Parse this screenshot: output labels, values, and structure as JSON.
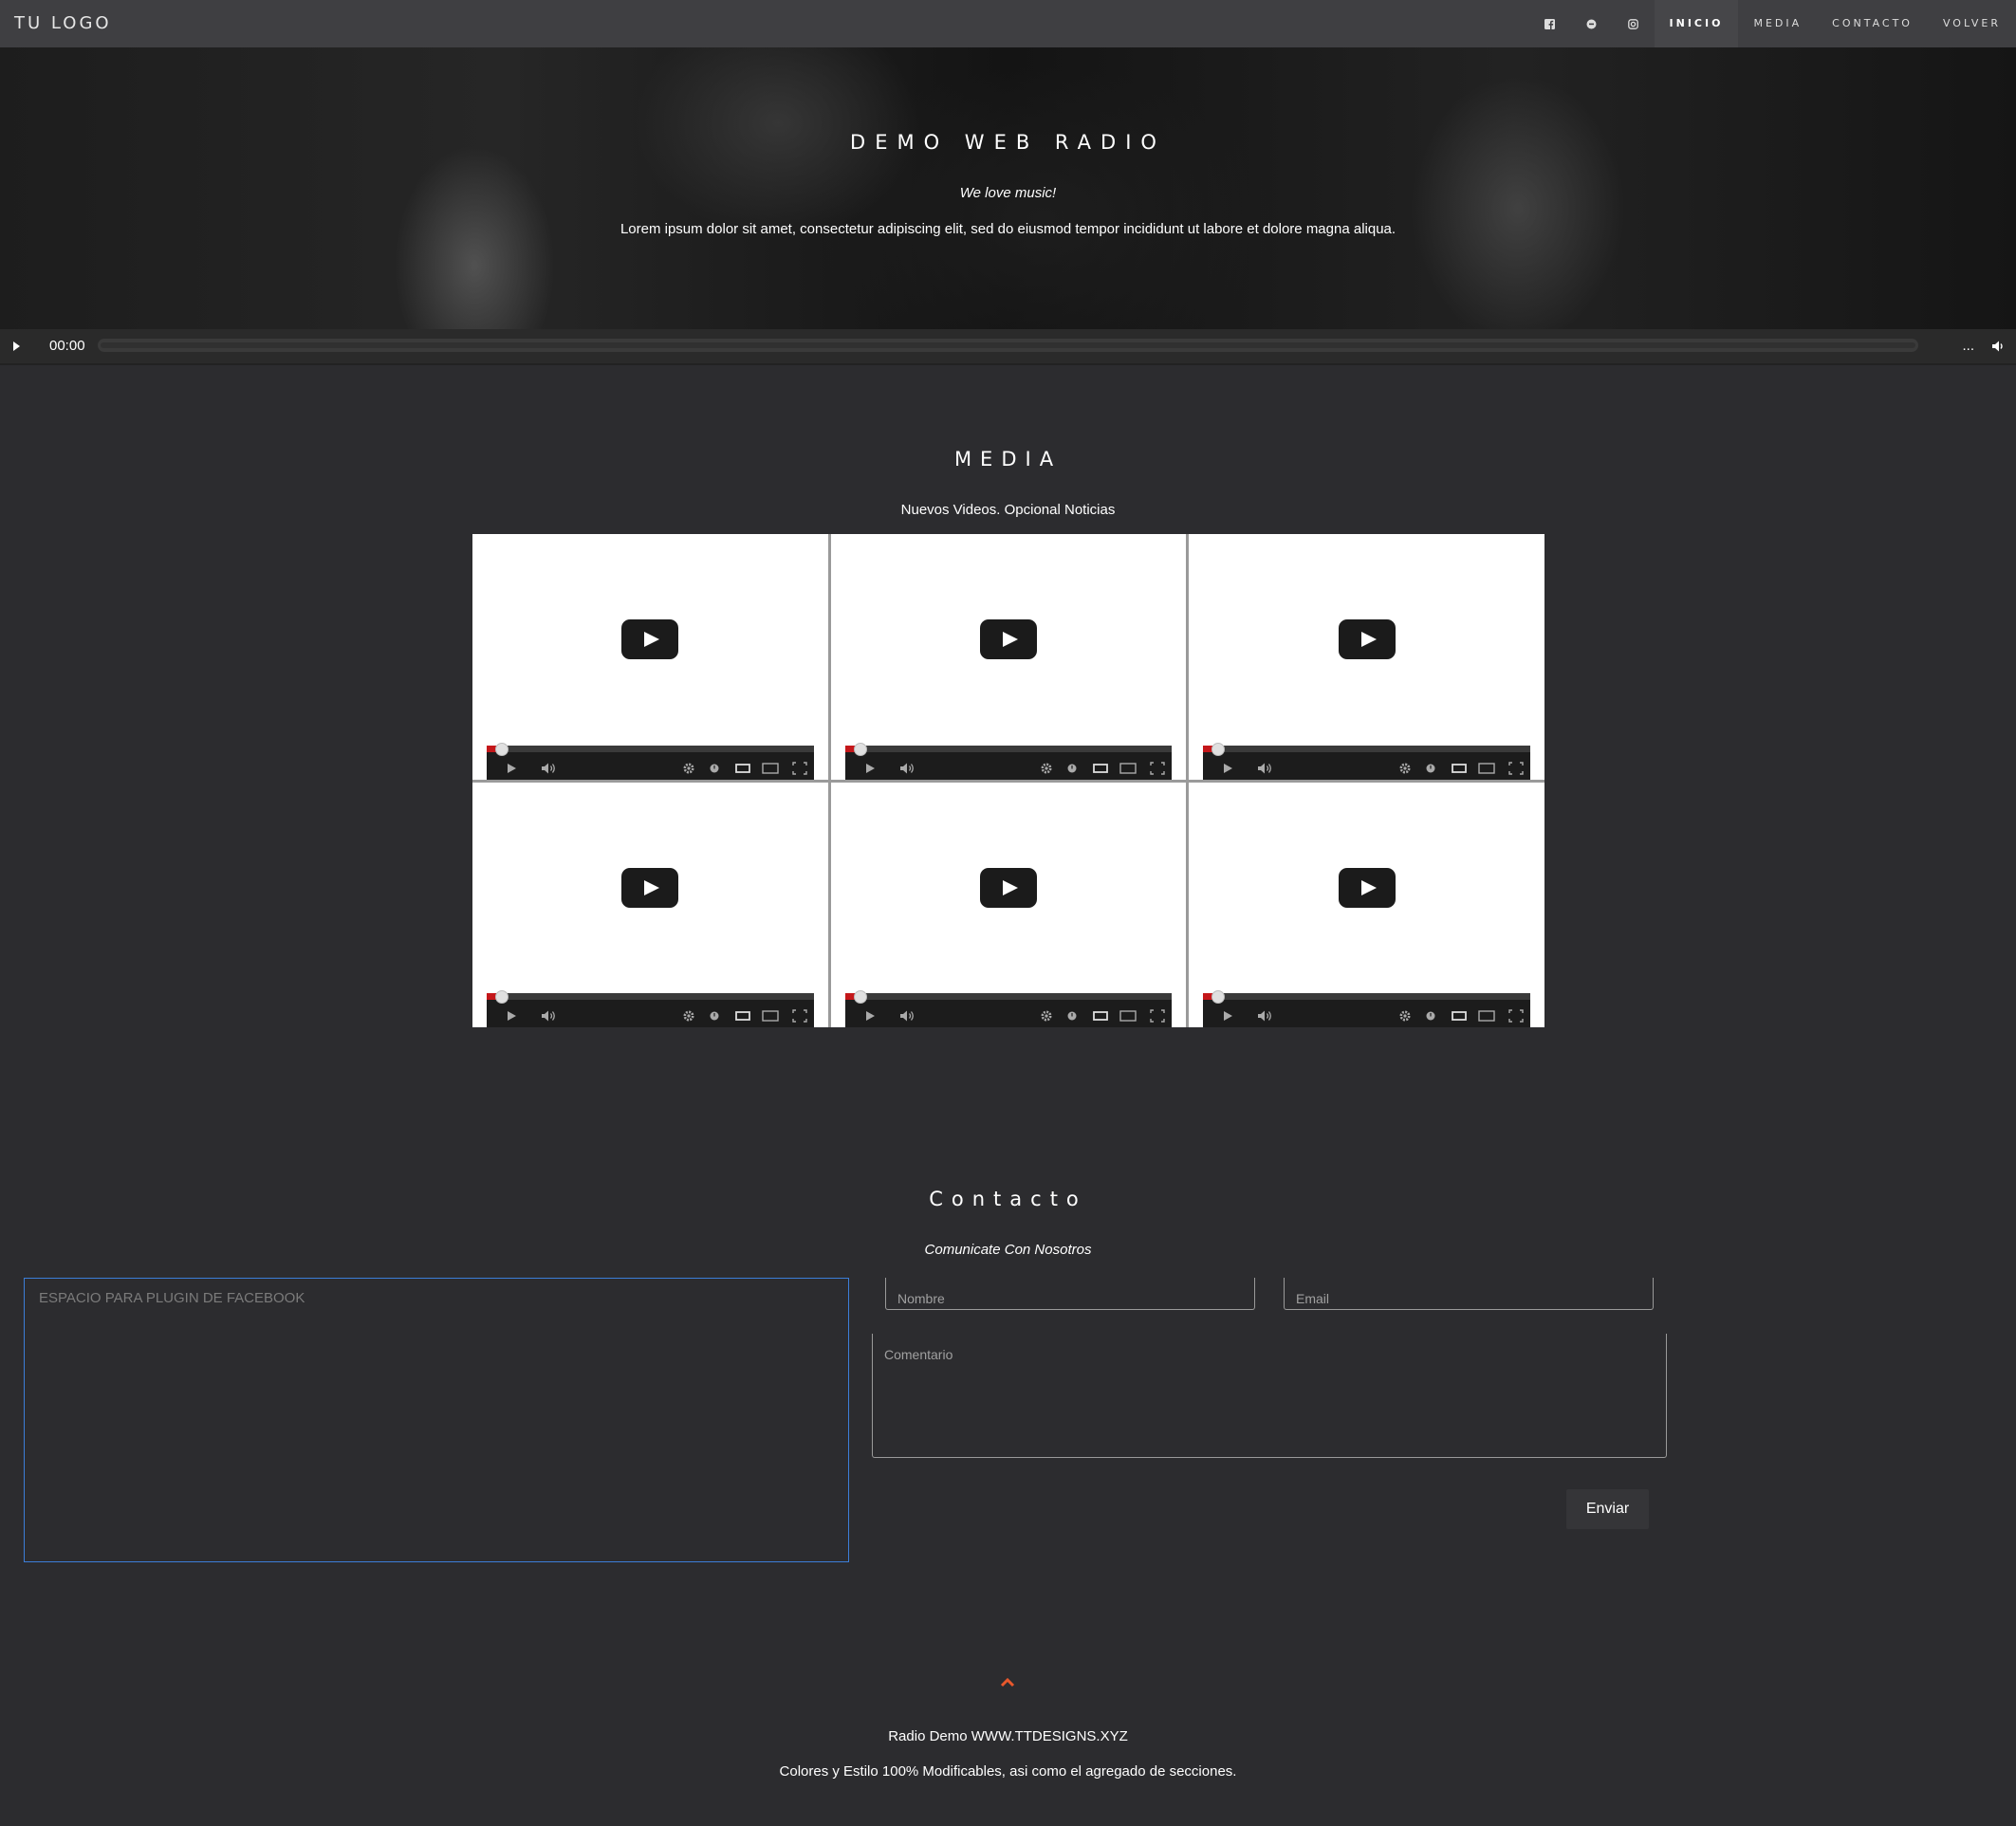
{
  "nav": {
    "logo": "TU LOGO",
    "social": [
      {
        "icon": "facebook-icon",
        "glyph": "f"
      },
      {
        "icon": "chat-icon",
        "glyph": "●"
      },
      {
        "icon": "instagram-icon",
        "glyph": "◎"
      }
    ],
    "links": [
      {
        "label": "INICIO",
        "active": true
      },
      {
        "label": "MEDIA",
        "active": false
      },
      {
        "label": "CONTACTO",
        "active": false
      },
      {
        "label": "VOLVER",
        "active": false
      }
    ]
  },
  "hero": {
    "title": "DEMO WEB RADIO",
    "tagline": "We love music!",
    "text": "Lorem ipsum dolor sit amet, consectetur adipiscing elit, sed do eiusmod tempor incididunt ut labore et dolore magna aliqua."
  },
  "player": {
    "time": "00:00",
    "more": "..."
  },
  "media": {
    "title": "MEDIA",
    "subtitle": "Nuevos Videos. Opcional Noticias",
    "video_count": 6
  },
  "contact": {
    "title": "Contacto",
    "subtitle": "Comunicate Con Nosotros",
    "facebook_placeholder": "ESPACIO PARA PLUGIN DE FACEBOOK",
    "name_placeholder": "Nombre",
    "email_placeholder": "Email",
    "comment_placeholder": "Comentario",
    "send_label": "Enviar"
  },
  "footer": {
    "line1_prefix": "Radio Demo ",
    "line1_link": "WWW.TTDESIGNS.XYZ",
    "line2": "Colores y Estilo 100% Modificables, asi como el agregado de secciones."
  },
  "colors": {
    "background": "#2c2c2f",
    "navbar": "#3f3f42",
    "accent_arrow": "#e8582c",
    "facebook_box_border": "#3c7ed8"
  }
}
